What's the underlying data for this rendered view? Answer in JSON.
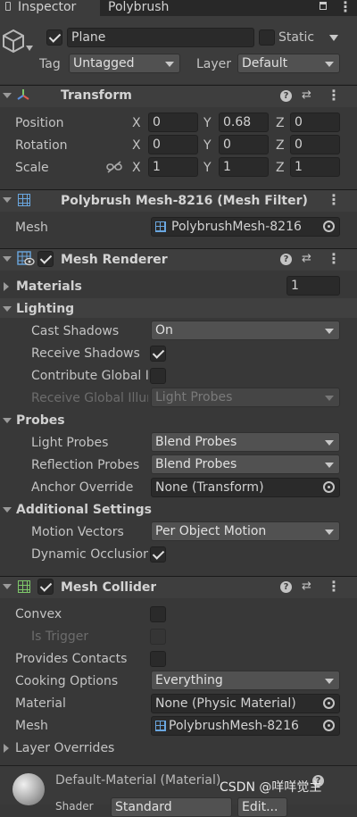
{
  "tabs": {
    "inspector": "Inspector",
    "polybrush": "Polybrush"
  },
  "object": {
    "name": "Plane",
    "static_label": "Static",
    "tag_label": "Tag",
    "tag_value": "Untagged",
    "layer_label": "Layer",
    "layer_value": "Default"
  },
  "transform": {
    "title": "Transform",
    "position": {
      "label": "Position",
      "x": "0",
      "y": "0.68",
      "z": "0"
    },
    "rotation": {
      "label": "Rotation",
      "x": "0",
      "y": "0",
      "z": "0"
    },
    "scale": {
      "label": "Scale",
      "x": "1",
      "y": "1",
      "z": "1"
    },
    "axis_x": "X",
    "axis_y": "Y",
    "axis_z": "Z"
  },
  "mesh_filter": {
    "title": "Polybrush Mesh-8216 (Mesh Filter)",
    "mesh_label": "Mesh",
    "mesh_value": "PolybrushMesh-8216"
  },
  "mesh_renderer": {
    "title": "Mesh Renderer",
    "materials_label": "Materials",
    "materials_count": "1",
    "lighting": "Lighting",
    "cast_shadows_label": "Cast Shadows",
    "cast_shadows_value": "On",
    "receive_shadows_label": "Receive Shadows",
    "contribute_gi_label": "Contribute Global Illumination",
    "receive_gi_label": "Receive Global Illumination",
    "receive_gi_value": "Light Probes",
    "probes": "Probes",
    "light_probes_label": "Light Probes",
    "light_probes_value": "Blend Probes",
    "reflection_probes_label": "Reflection Probes",
    "reflection_probes_value": "Blend Probes",
    "anchor_override_label": "Anchor Override",
    "anchor_override_value": "None (Transform)",
    "additional": "Additional Settings",
    "motion_vectors_label": "Motion Vectors",
    "motion_vectors_value": "Per Object Motion",
    "dynamic_occlusion_label": "Dynamic Occlusion"
  },
  "mesh_collider": {
    "title": "Mesh Collider",
    "convex_label": "Convex",
    "is_trigger_label": "Is Trigger",
    "provides_contacts_label": "Provides Contacts",
    "cooking_label": "Cooking Options",
    "cooking_value": "Everything",
    "material_label": "Material",
    "material_value": "None (Physic Material)",
    "mesh_label": "Mesh",
    "mesh_value": "PolybrushMesh-8216",
    "layer_overrides_label": "Layer Overrides"
  },
  "material": {
    "name": "Default-Material (Material)",
    "shader_label": "Shader",
    "shader_value": "Standard",
    "edit_label": "Edit..."
  },
  "watermark": "CSDN @咩咩觉主"
}
